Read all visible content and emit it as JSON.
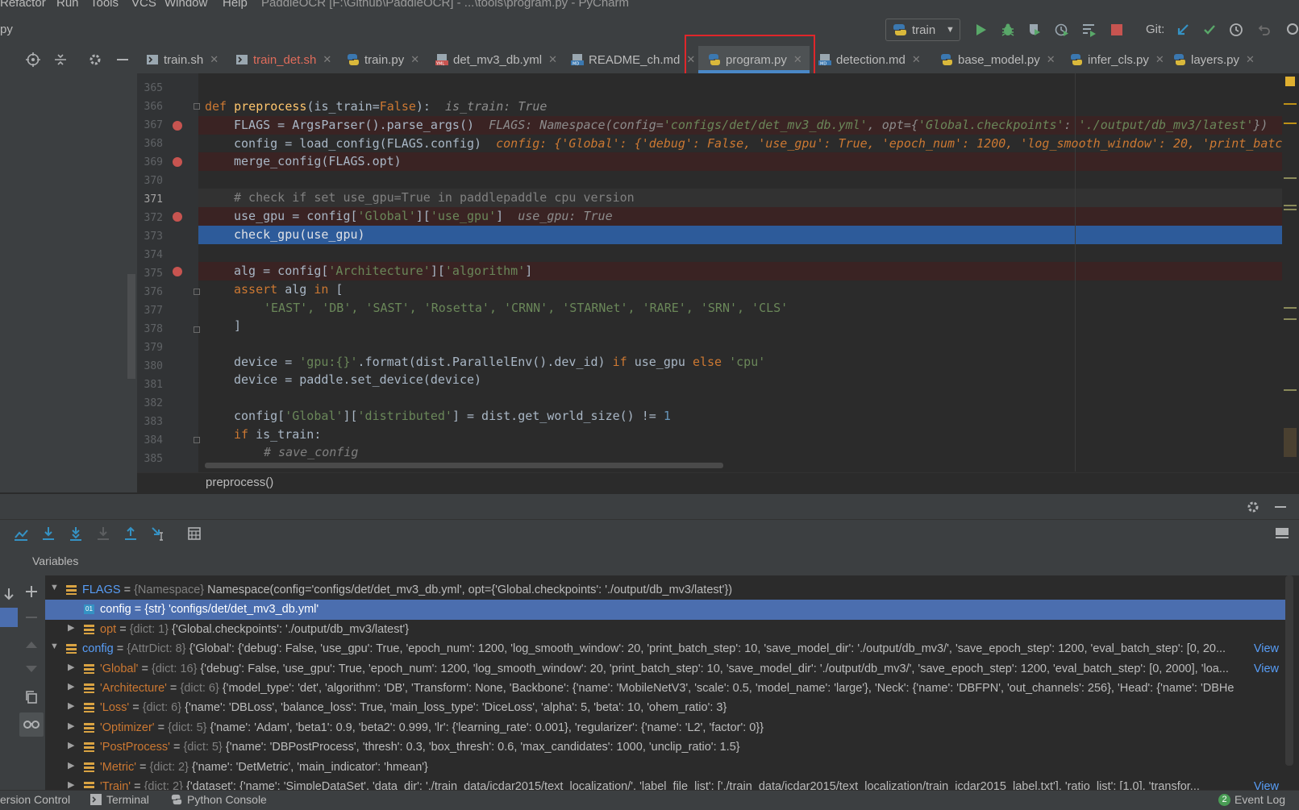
{
  "menu": [
    "Refactor",
    "Run",
    "Tools",
    "VCS",
    "Window",
    "Help"
  ],
  "window_title": "PaddleOCR [F:\\Github\\PaddleOCR] - ...\\tools\\program.py - PyCharm",
  "breadcrumb_file": "py",
  "run_config": "train",
  "git_label": "Git:",
  "tabs": [
    {
      "label": "train.sh",
      "type": "sh",
      "color": "#bbbbbb"
    },
    {
      "label": "train_det.sh",
      "type": "sh",
      "color": "#e06c5b"
    },
    {
      "label": "train.py",
      "type": "py",
      "color": "#bbbbbb"
    },
    {
      "label": "det_mv3_db.yml",
      "type": "yml",
      "color": "#bbbbbb"
    },
    {
      "label": "README_ch.md",
      "type": "md",
      "color": "#bbbbbb"
    },
    {
      "label": "program.py",
      "type": "py",
      "color": "#bbbbbb",
      "active": true
    },
    {
      "label": "detection.md",
      "type": "md",
      "color": "#bbbbbb"
    },
    {
      "label": "base_model.py",
      "type": "py",
      "color": "#bbbbbb"
    },
    {
      "label": "infer_cls.py",
      "type": "py",
      "color": "#bbbbbb"
    },
    {
      "label": "layers.py",
      "type": "py",
      "color": "#bbbbbb"
    }
  ],
  "line_numbers": [
    "365",
    "366",
    "367",
    "368",
    "369",
    "370",
    "371",
    "372",
    "373",
    "374",
    "375",
    "376",
    "377",
    "378",
    "379",
    "380",
    "381",
    "382",
    "383",
    "384",
    "385"
  ],
  "code": {
    "l366_def": "def ",
    "l366_name": "preprocess",
    "l366_open": "(is_train=",
    "l366_false": "False",
    "l366_close": "):",
    "l366_hint": "is_train: True",
    "l367": "FLAGS = ArgsParser().parse_args()",
    "l367_hint_pre": "FLAGS: Namespace(config=",
    "l367_hint_s1": "'configs/det/det_mv3_db.yml'",
    "l367_hint_mid": ", opt={",
    "l367_hint_s2": "'Global.checkpoints'",
    "l367_hint_colon": ": ",
    "l367_hint_s3": "'./output/db_mv3/latest'",
    "l367_hint_end": "})",
    "l368": "config = load_config(FLAGS.config)",
    "l368_hint": "config: {'Global': {'debug': False, 'use_gpu': True, 'epoch_num': 1200, 'log_smooth_window': 20, 'print_batch_",
    "l369": "merge_config(FLAGS.opt)",
    "l371": "# check if set use_gpu=True in paddlepaddle cpu version",
    "l372_a": "use_gpu = config[",
    "l372_s1": "'Global'",
    "l372_b": "][",
    "l372_s2": "'use_gpu'",
    "l372_c": "]",
    "l372_hint": "use_gpu: True",
    "l373": "check_gpu(use_gpu)",
    "l375_a": "alg = config[",
    "l375_s1": "'Architecture'",
    "l375_b": "][",
    "l375_s2": "'algorithm'",
    "l375_c": "]",
    "l376_kw": "assert ",
    "l376_a": "alg ",
    "l376_in": "in",
    "l376_b": " [",
    "l377": "'EAST', 'DB', 'SAST', 'Rosetta', 'CRNN', 'STARNet', 'RARE', 'SRN', 'CLS'",
    "l378": "]",
    "l380_a": "device = ",
    "l380_s1": "'gpu:{}'",
    "l380_b": ".format(dist.ParallelEnv().dev_id) ",
    "l380_if": "if",
    "l380_c": " use_gpu ",
    "l380_else": "else",
    "l380_s2": " 'cpu'",
    "l381": "device = paddle.set_device(device)",
    "l383_a": "config[",
    "l383_s1": "'Global'",
    "l383_b": "][",
    "l383_s2": "'distributed'",
    "l383_c": "] = dist.get_world_size() != ",
    "l383_n": "1",
    "l384_kw": "if ",
    "l384_a": "is_train:",
    "l385": "# save_config"
  },
  "current_function": "preprocess()",
  "variables_title": "Variables",
  "variables": [
    {
      "indent": 0,
      "expanded": true,
      "icon": "list",
      "name": "FLAGS",
      "name_style": "blue",
      "type": "{Namespace}",
      "value": "Namespace(config='configs/det/det_mv3_db.yml', opt={'Global.checkpoints': './output/db_mv3/latest'})",
      "view": ""
    },
    {
      "indent": 1,
      "expanded": null,
      "icon": "str",
      "name": "config",
      "name_style": "sel",
      "type": "{str}",
      "value": "'configs/det/det_mv3_db.yml'",
      "view": "",
      "selected": true
    },
    {
      "indent": 1,
      "expanded": false,
      "icon": "list",
      "name": "opt",
      "name_style": "orange",
      "type": "{dict: 1}",
      "value": "{'Global.checkpoints': './output/db_mv3/latest'}",
      "view": ""
    },
    {
      "indent": 0,
      "expanded": true,
      "icon": "list",
      "name": "config",
      "name_style": "blue",
      "type": "{AttrDict: 8}",
      "value": "{'Global': {'debug': False, 'use_gpu': True, 'epoch_num': 1200, 'log_smooth_window': 20, 'print_batch_step': 10, 'save_model_dir': './output/db_mv3/', 'save_epoch_step': 1200, 'eval_batch_step': [0, 20...",
      "view": "View"
    },
    {
      "indent": 1,
      "expanded": false,
      "icon": "list",
      "name": "'Global'",
      "name_style": "orange",
      "type": "{dict: 16}",
      "value": "{'debug': False, 'use_gpu': True, 'epoch_num': 1200, 'log_smooth_window': 20, 'print_batch_step': 10, 'save_model_dir': './output/db_mv3/', 'save_epoch_step': 1200, 'eval_batch_step': [0, 2000], 'loa...",
      "view": "View"
    },
    {
      "indent": 1,
      "expanded": false,
      "icon": "list",
      "name": "'Architecture'",
      "name_style": "orange",
      "type": "{dict: 6}",
      "value": "{'model_type': 'det', 'algorithm': 'DB', 'Transform': None, 'Backbone': {'name': 'MobileNetV3', 'scale': 0.5, 'model_name': 'large'}, 'Neck': {'name': 'DBFPN', 'out_channels': 256}, 'Head': {'name': 'DBHe",
      "view": ""
    },
    {
      "indent": 1,
      "expanded": false,
      "icon": "list",
      "name": "'Loss'",
      "name_style": "orange",
      "type": "{dict: 6}",
      "value": "{'name': 'DBLoss', 'balance_loss': True, 'main_loss_type': 'DiceLoss', 'alpha': 5, 'beta': 10, 'ohem_ratio': 3}",
      "view": ""
    },
    {
      "indent": 1,
      "expanded": false,
      "icon": "list",
      "name": "'Optimizer'",
      "name_style": "orange",
      "type": "{dict: 5}",
      "value": "{'name': 'Adam', 'beta1': 0.9, 'beta2': 0.999, 'lr': {'learning_rate': 0.001}, 'regularizer': {'name': 'L2', 'factor': 0}}",
      "view": ""
    },
    {
      "indent": 1,
      "expanded": false,
      "icon": "list",
      "name": "'PostProcess'",
      "name_style": "orange",
      "type": "{dict: 5}",
      "value": "{'name': 'DBPostProcess', 'thresh': 0.3, 'box_thresh': 0.6, 'max_candidates': 1000, 'unclip_ratio': 1.5}",
      "view": ""
    },
    {
      "indent": 1,
      "expanded": false,
      "icon": "list",
      "name": "'Metric'",
      "name_style": "orange",
      "type": "{dict: 2}",
      "value": "{'name': 'DetMetric', 'main_indicator': 'hmean'}",
      "view": ""
    },
    {
      "indent": 1,
      "expanded": false,
      "icon": "list",
      "name": "'Train'",
      "name_style": "orange",
      "type": "{dict: 2}",
      "value": "{'dataset': {'name': 'SimpleDataSet', 'data_dir': './train_data/icdar2015/text_localization/', 'label_file_list': ['./train_data/icdar2015/text_localization/train_icdar2015_label.txt'], 'ratio_list': [1.0], 'transfor...",
      "view": "View"
    }
  ],
  "status": {
    "version_control": "ersion Control",
    "terminal": "Terminal",
    "python_console": "Python Console",
    "event_log_count": "2",
    "event_log": "Event Log"
  }
}
